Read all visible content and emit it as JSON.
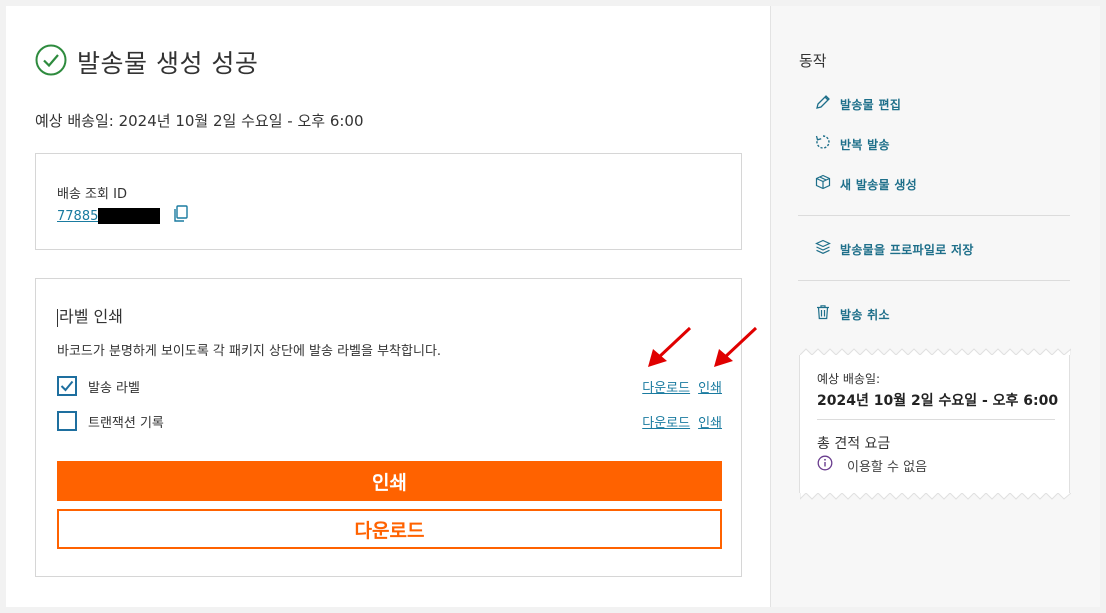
{
  "main": {
    "title": "발송물 생성 성공",
    "eta": "예상 배송일: 2024년 10월 2일 수요일 - 오후 6:00",
    "tracking": {
      "label": "배송 조회 ID",
      "id_visible": "77885"
    },
    "label_section": {
      "title": "라벨 인쇄",
      "description": "바코드가 분명하게 보이도록 각 패키지 상단에 발송 라벨을 부착합니다.",
      "documents": [
        {
          "name": "발송 라벨",
          "checked": true,
          "download": "다운로드",
          "print": "인쇄"
        },
        {
          "name": "트랜잭션 기록",
          "checked": false,
          "download": "다운로드",
          "print": "인쇄"
        }
      ],
      "print_button": "인쇄",
      "download_button": "다운로드"
    }
  },
  "sidebar": {
    "title": "동작",
    "actions": [
      {
        "label": "발송물 편집",
        "icon": "pencil-icon"
      },
      {
        "label": "반복 발송",
        "icon": "repeat-icon"
      },
      {
        "label": "새 발송물 생성",
        "icon": "box-icon"
      },
      {
        "label": "발송물을 프로파일로 저장",
        "icon": "layers-icon"
      },
      {
        "label": "발송 취소",
        "icon": "trash-icon"
      }
    ],
    "summary": {
      "eta_label": "예상 배송일:",
      "eta_value": "2024년 10월 2일 수요일 - 오후 6:00",
      "total_label": "총 견적 요금",
      "unavailable": "이용할 수 없음"
    }
  },
  "colors": {
    "accent": "#ff6200",
    "link": "#1a7ba0",
    "success": "#2e8b3e",
    "checkbox": "#1e6f9f",
    "annotation_arrow": "#e00000"
  }
}
